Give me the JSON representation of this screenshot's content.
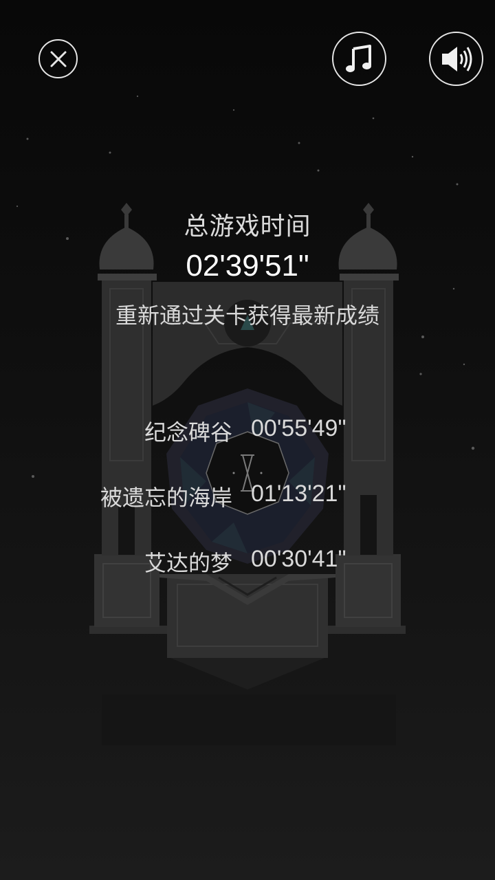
{
  "controls": {
    "close_icon": "close-icon",
    "music_icon": "music-note-icon",
    "sound_icon": "speaker-icon"
  },
  "stats": {
    "title": "总游戏时间",
    "total_time": "02'39'51\"",
    "hint": "重新通过关卡获得最新成绩"
  },
  "levels": [
    {
      "name": "纪念碑谷",
      "time": "00'55'49\""
    },
    {
      "name": "被遗忘的海岸",
      "time": "01'13'21\""
    },
    {
      "name": "艾达的梦",
      "time": "00'30'41\""
    }
  ],
  "colors": {
    "background": "#0d0d0d",
    "text": "#dcdcdc",
    "temple": "#3a3a3a"
  }
}
